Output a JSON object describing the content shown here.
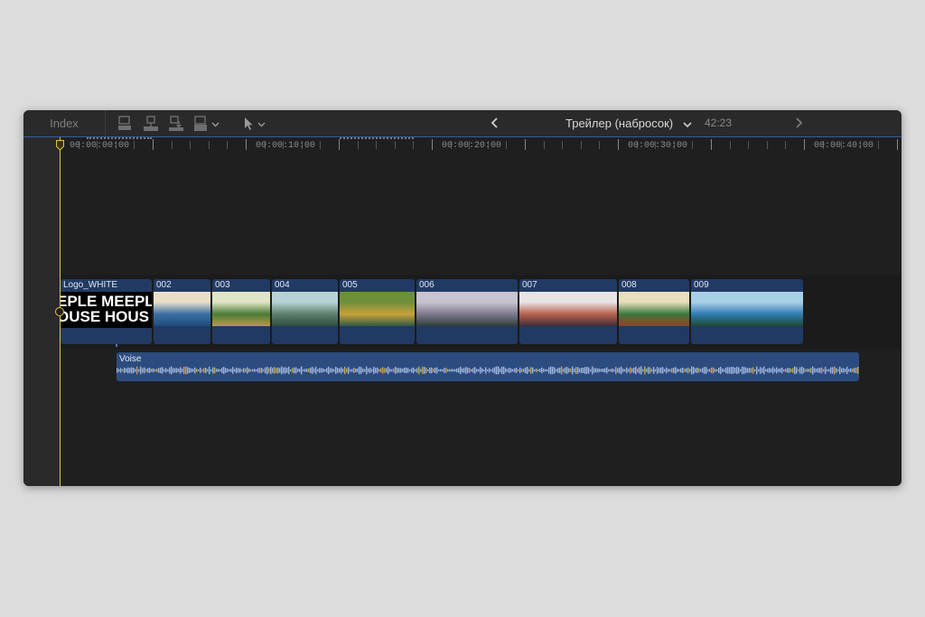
{
  "toolbar": {
    "index_label": "Index",
    "project_title": "Трейлер (наброс­ок)",
    "duration": "42:23"
  },
  "ruler": {
    "timecodes": [
      "00:00:00:00",
      "00:00:10:00",
      "00:00:20:00",
      "00:00:30:00",
      "00:00:40:00"
    ]
  },
  "clips": [
    {
      "label": "Logo_WHITE",
      "logo_text_line1": "EPLE MEEPL",
      "logo_text_line2": "OUSE HOUS"
    },
    {
      "label": "002",
      "colors": [
        "#e9dfc9",
        "#3c6fa3",
        "#1f4b78"
      ]
    },
    {
      "label": "003",
      "colors": [
        "#dfe5c6",
        "#4a7a36",
        "#b99a4a"
      ]
    },
    {
      "label": "004",
      "colors": [
        "#b7d2d6",
        "#5c7f6b",
        "#2e4f3f"
      ]
    },
    {
      "label": "005",
      "colors": [
        "#6d8f3a",
        "#c7a23a",
        "#2f5a45"
      ]
    },
    {
      "label": "006",
      "colors": [
        "#c7c3cf",
        "#7e7a8e",
        "#2f3d3a"
      ]
    },
    {
      "label": "007",
      "colors": [
        "#e8e3e6",
        "#b8614d",
        "#3f2d3a"
      ]
    },
    {
      "label": "008",
      "colors": [
        "#e8dfbd",
        "#3a7a3d",
        "#9c3b2a"
      ]
    },
    {
      "label": "009",
      "colors": [
        "#a9cfe7",
        "#2f7db2",
        "#1d4a33"
      ]
    }
  ],
  "audio": {
    "label": "Voise"
  },
  "colors": {
    "clip_bg": "#213a63",
    "audio_bg": "#2c4c80",
    "playhead": "#e2c640",
    "toolbar_accent": "#3a5aa0"
  }
}
